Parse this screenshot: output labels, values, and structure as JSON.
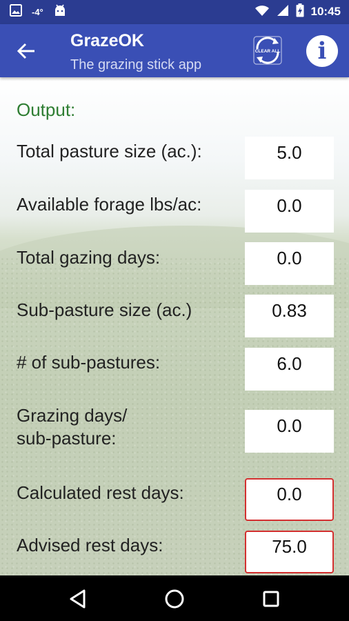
{
  "status_bar": {
    "temperature": "-4°",
    "time": "10:45",
    "icons": [
      "image-notification-icon",
      "android-notification-icon",
      "wifi-icon",
      "cellular-signal-icon",
      "battery-charging-icon"
    ]
  },
  "app_bar": {
    "title": "GrazeOK",
    "subtitle": "The grazing stick app",
    "clear_all_label": "CLEAR ALL",
    "info_glyph": "i",
    "background_color": "#3a4fb5",
    "status_bar_color": "#2b3c91"
  },
  "output": {
    "section_title": "Output:",
    "rows": [
      {
        "label": "Total pasture size (ac.):",
        "value": "5.0"
      },
      {
        "label": "Available forage lbs/ac:",
        "value": "0.0"
      },
      {
        "label": "Total gazing days:",
        "value": "0.0"
      },
      {
        "label": "Sub-pasture size (ac.)",
        "value": "0.83"
      },
      {
        "label": "# of sub-pastures:",
        "value": "6.0"
      },
      {
        "label": "Grazing days/\n sub-pasture:",
        "value": "0.0"
      },
      {
        "label": "Calculated rest days:",
        "value": "0.0"
      },
      {
        "label": "Advised rest days:",
        "value": "75.0"
      }
    ]
  },
  "colors": {
    "section_title": "#2e7d32",
    "alert_border": "#d32f2f"
  },
  "nav_bar": {
    "icons": [
      "back-triangle-icon",
      "home-circle-icon",
      "recents-square-icon"
    ]
  }
}
